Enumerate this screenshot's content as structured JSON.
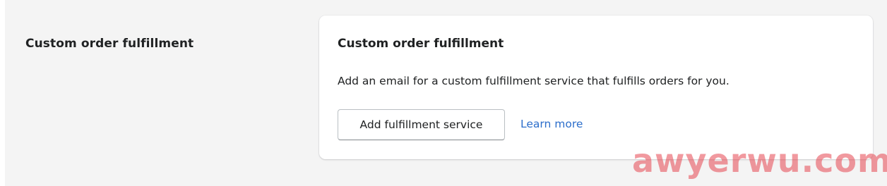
{
  "section": {
    "title": "Custom order fulfillment"
  },
  "card": {
    "title": "Custom order fulfillment",
    "description": "Add an email for a custom fulfillment service that fulfills orders for you.",
    "primary_button_label": "Add fulfillment service",
    "link_label": "Learn more"
  },
  "colors": {
    "page_background": "#f4f4f4",
    "card_background": "#ffffff",
    "text": "#202223",
    "link": "#2c6ecb",
    "watermark": "#e64650"
  },
  "watermark": {
    "text": "awyerwu.com"
  }
}
